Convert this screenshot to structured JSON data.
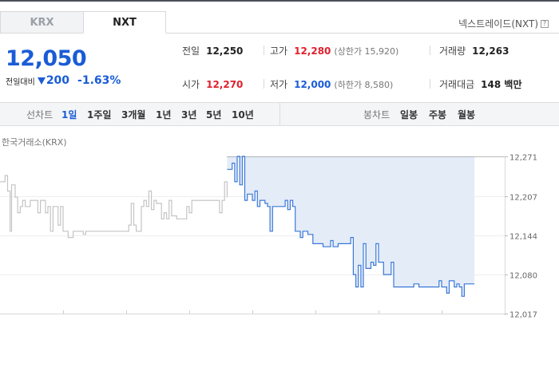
{
  "tabs": [
    {
      "label": "KRX",
      "active": false
    },
    {
      "label": "NXT",
      "active": true
    }
  ],
  "market_name": "넥스트레이드(NXT)",
  "help_icon": "?",
  "price": {
    "current": "12,050",
    "change_label": "전일대비",
    "change_direction": "down",
    "change_amount": "200",
    "change_percent": "-1.63%"
  },
  "stats": {
    "prev_close": {
      "label": "전일",
      "value": "12,250"
    },
    "high": {
      "label": "고가",
      "value": "12,280",
      "sub": "(상한가 15,920)"
    },
    "volume": {
      "label": "거래량",
      "value": "12,263"
    },
    "open": {
      "label": "시가",
      "value": "12,270"
    },
    "low": {
      "label": "저가",
      "value": "12,000",
      "sub": "(하한가 8,580)"
    },
    "trade_value": {
      "label": "거래대금",
      "value": "148 백만"
    }
  },
  "line_periods": {
    "label": "선차트",
    "items": [
      "1일",
      "1주일",
      "3개월",
      "1년",
      "3년",
      "5년",
      "10년"
    ],
    "selected": "1일"
  },
  "candle_periods": {
    "label": "봉차트",
    "items": [
      "일봉",
      "주봉",
      "월봉"
    ]
  },
  "chart_data": {
    "type": "line",
    "source_label": "한국거래소(KRX)",
    "y_ticks": [
      "12,271",
      "12,207",
      "12,144",
      "12,080",
      "12,017"
    ],
    "ylim": [
      12017,
      12271
    ],
    "reference_line": 12271,
    "x_range": [
      0,
      100
    ],
    "colors": {
      "krx_series": "#c4c4c4",
      "nxt_series": "#3a78d8",
      "fill": "#e4ecf8"
    },
    "series": [
      {
        "points": [
          [
            0,
            12230
          ],
          [
            1,
            12240
          ],
          [
            1.5,
            12215
          ],
          [
            2,
            12150
          ],
          [
            2.3,
            12225
          ],
          [
            3,
            12205
          ],
          [
            3.5,
            12180
          ],
          [
            4,
            12190
          ],
          [
            4.5,
            12200
          ],
          [
            5,
            12190
          ],
          [
            6,
            12200
          ],
          [
            7,
            12200
          ],
          [
            7.5,
            12180
          ],
          [
            8,
            12200
          ],
          [
            9,
            12180
          ],
          [
            9.5,
            12190
          ],
          [
            10,
            12150
          ],
          [
            10.5,
            12190
          ],
          [
            11,
            12190
          ],
          [
            11.5,
            12160
          ],
          [
            12,
            12190
          ],
          [
            12.5,
            12150
          ],
          [
            13,
            12150
          ],
          [
            13.5,
            12140
          ],
          [
            14,
            12140
          ],
          [
            14.5,
            12150
          ],
          [
            15,
            12150
          ],
          [
            16,
            12150
          ],
          [
            16.5,
            12145
          ],
          [
            17,
            12150
          ],
          [
            18,
            12150
          ],
          [
            19,
            12150
          ],
          [
            20,
            12150
          ],
          [
            21,
            12150
          ],
          [
            22,
            12150
          ],
          [
            23,
            12150
          ],
          [
            24,
            12150
          ],
          [
            25,
            12150
          ],
          [
            25.5,
            12160
          ],
          [
            26,
            12195
          ],
          [
            26.5,
            12160
          ],
          [
            27,
            12150
          ],
          [
            28,
            12190
          ],
          [
            28.5,
            12200
          ],
          [
            29,
            12190
          ],
          [
            29.5,
            12215
          ],
          [
            30,
            12185
          ],
          [
            30.5,
            12200
          ],
          [
            31,
            12195
          ],
          [
            32,
            12170
          ],
          [
            32.5,
            12180
          ],
          [
            33,
            12170
          ],
          [
            33.5,
            12200
          ],
          [
            34,
            12175
          ],
          [
            35,
            12170
          ],
          [
            36,
            12170
          ],
          [
            37,
            12190
          ],
          [
            37.5,
            12180
          ],
          [
            38,
            12200
          ],
          [
            39,
            12200
          ],
          [
            40,
            12200
          ],
          [
            41,
            12200
          ],
          [
            42,
            12200
          ],
          [
            43,
            12200
          ],
          [
            43.5,
            12180
          ],
          [
            44,
            12200
          ],
          [
            44.5,
            12230
          ],
          [
            45,
            12205
          ]
        ]
      },
      {
        "points": [
          [
            45,
            12250
          ],
          [
            46,
            12260
          ],
          [
            46.5,
            12230
          ],
          [
            47,
            12271
          ],
          [
            47.5,
            12225
          ],
          [
            48,
            12271
          ],
          [
            48.5,
            12200
          ],
          [
            49,
            12210
          ],
          [
            50,
            12200
          ],
          [
            50.5,
            12215
          ],
          [
            51,
            12190
          ],
          [
            51.5,
            12200
          ],
          [
            52,
            12200
          ],
          [
            52.5,
            12195
          ],
          [
            53,
            12190
          ],
          [
            53.5,
            12150
          ],
          [
            54,
            12190
          ],
          [
            55,
            12190
          ],
          [
            56,
            12190
          ],
          [
            56.5,
            12200
          ],
          [
            57,
            12185
          ],
          [
            57.5,
            12200
          ],
          [
            58,
            12190
          ],
          [
            58.5,
            12150
          ],
          [
            59,
            12150
          ],
          [
            59.5,
            12140
          ],
          [
            60,
            12150
          ],
          [
            61,
            12145
          ],
          [
            62,
            12130
          ],
          [
            63,
            12130
          ],
          [
            64,
            12125
          ],
          [
            65,
            12125
          ],
          [
            65.5,
            12135
          ],
          [
            66,
            12125
          ],
          [
            67,
            12130
          ],
          [
            68,
            12130
          ],
          [
            69,
            12130
          ],
          [
            69.5,
            12140
          ],
          [
            70,
            12080
          ],
          [
            70.5,
            12060
          ],
          [
            71,
            12095
          ],
          [
            71.5,
            12060
          ],
          [
            72,
            12130
          ],
          [
            72.5,
            12090
          ],
          [
            73,
            12090
          ],
          [
            73.5,
            12100
          ],
          [
            74,
            12095
          ],
          [
            74.5,
            12130
          ],
          [
            75,
            12100
          ],
          [
            75.5,
            12100
          ],
          [
            76,
            12080
          ],
          [
            77,
            12080
          ],
          [
            77.5,
            12100
          ],
          [
            78,
            12060
          ],
          [
            79,
            12060
          ],
          [
            80,
            12060
          ],
          [
            81,
            12060
          ],
          [
            82,
            12065
          ],
          [
            83,
            12060
          ],
          [
            84,
            12060
          ],
          [
            85,
            12060
          ],
          [
            86,
            12060
          ],
          [
            87,
            12070
          ],
          [
            87.5,
            12060
          ],
          [
            88,
            12060
          ],
          [
            88.5,
            12050
          ],
          [
            89,
            12070
          ],
          [
            90,
            12060
          ],
          [
            90.5,
            12065
          ],
          [
            91,
            12060
          ],
          [
            91.5,
            12045
          ],
          [
            92,
            12065
          ],
          [
            93,
            12065
          ],
          [
            94,
            12065
          ]
        ]
      }
    ]
  }
}
